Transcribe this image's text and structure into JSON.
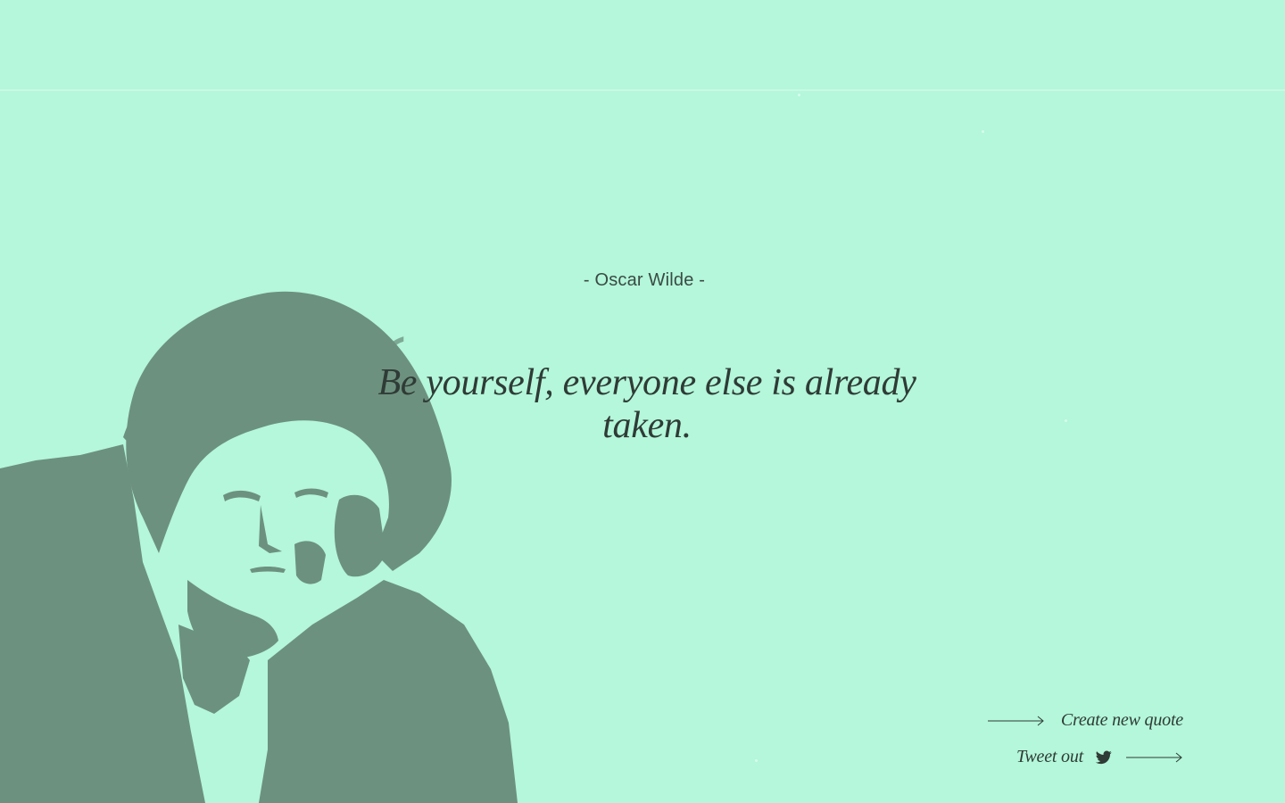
{
  "quote": {
    "author_line": "- Oscar Wilde -",
    "text": "Be yourself, everyone else is already taken.",
    "open_quote_glyph": "“"
  },
  "actions": {
    "create_label": "Create new quote",
    "tweet_label": "Tweet out"
  },
  "icons": {
    "create_arrow": "arrow-right-icon",
    "tweet_bird": "twitter-icon",
    "tweet_arrow": "arrow-right-icon"
  },
  "colors": {
    "background": "#b4f7da",
    "portrait": "#6d917f",
    "text": "#2f3b36"
  }
}
